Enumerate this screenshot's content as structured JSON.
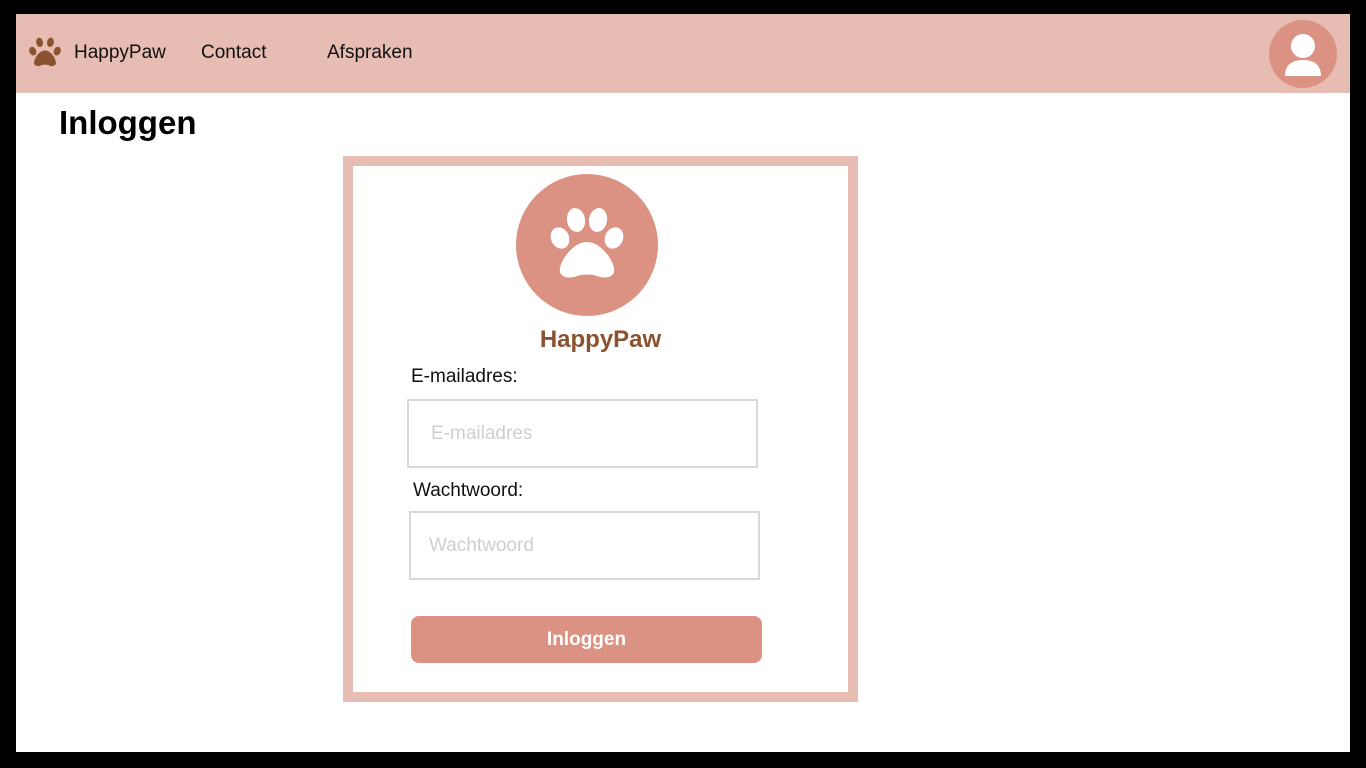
{
  "nav": {
    "brand": "HappyPaw",
    "links": [
      {
        "label": "Contact"
      },
      {
        "label": "Afspraken"
      }
    ]
  },
  "page": {
    "title": "Inloggen"
  },
  "login_card": {
    "brand": "HappyPaw",
    "email_label": "E-mailadres:",
    "email_placeholder": "E-mailadres",
    "email_value": "",
    "password_label": "Wachtwoord:",
    "password_placeholder": "Wachtwoord",
    "password_value": "",
    "submit_label": "Inloggen"
  },
  "icons": {
    "nav_logo": "paw-icon",
    "card_logo": "paw-icon",
    "avatar": "user-icon"
  },
  "colors": {
    "navbar": "#e6bcb3",
    "accent": "#dc9283",
    "brand_text": "#8b5230",
    "nav_paw": "#8b5230",
    "card_border": "#e6bcb3",
    "input_border": "#d9d9d9"
  }
}
